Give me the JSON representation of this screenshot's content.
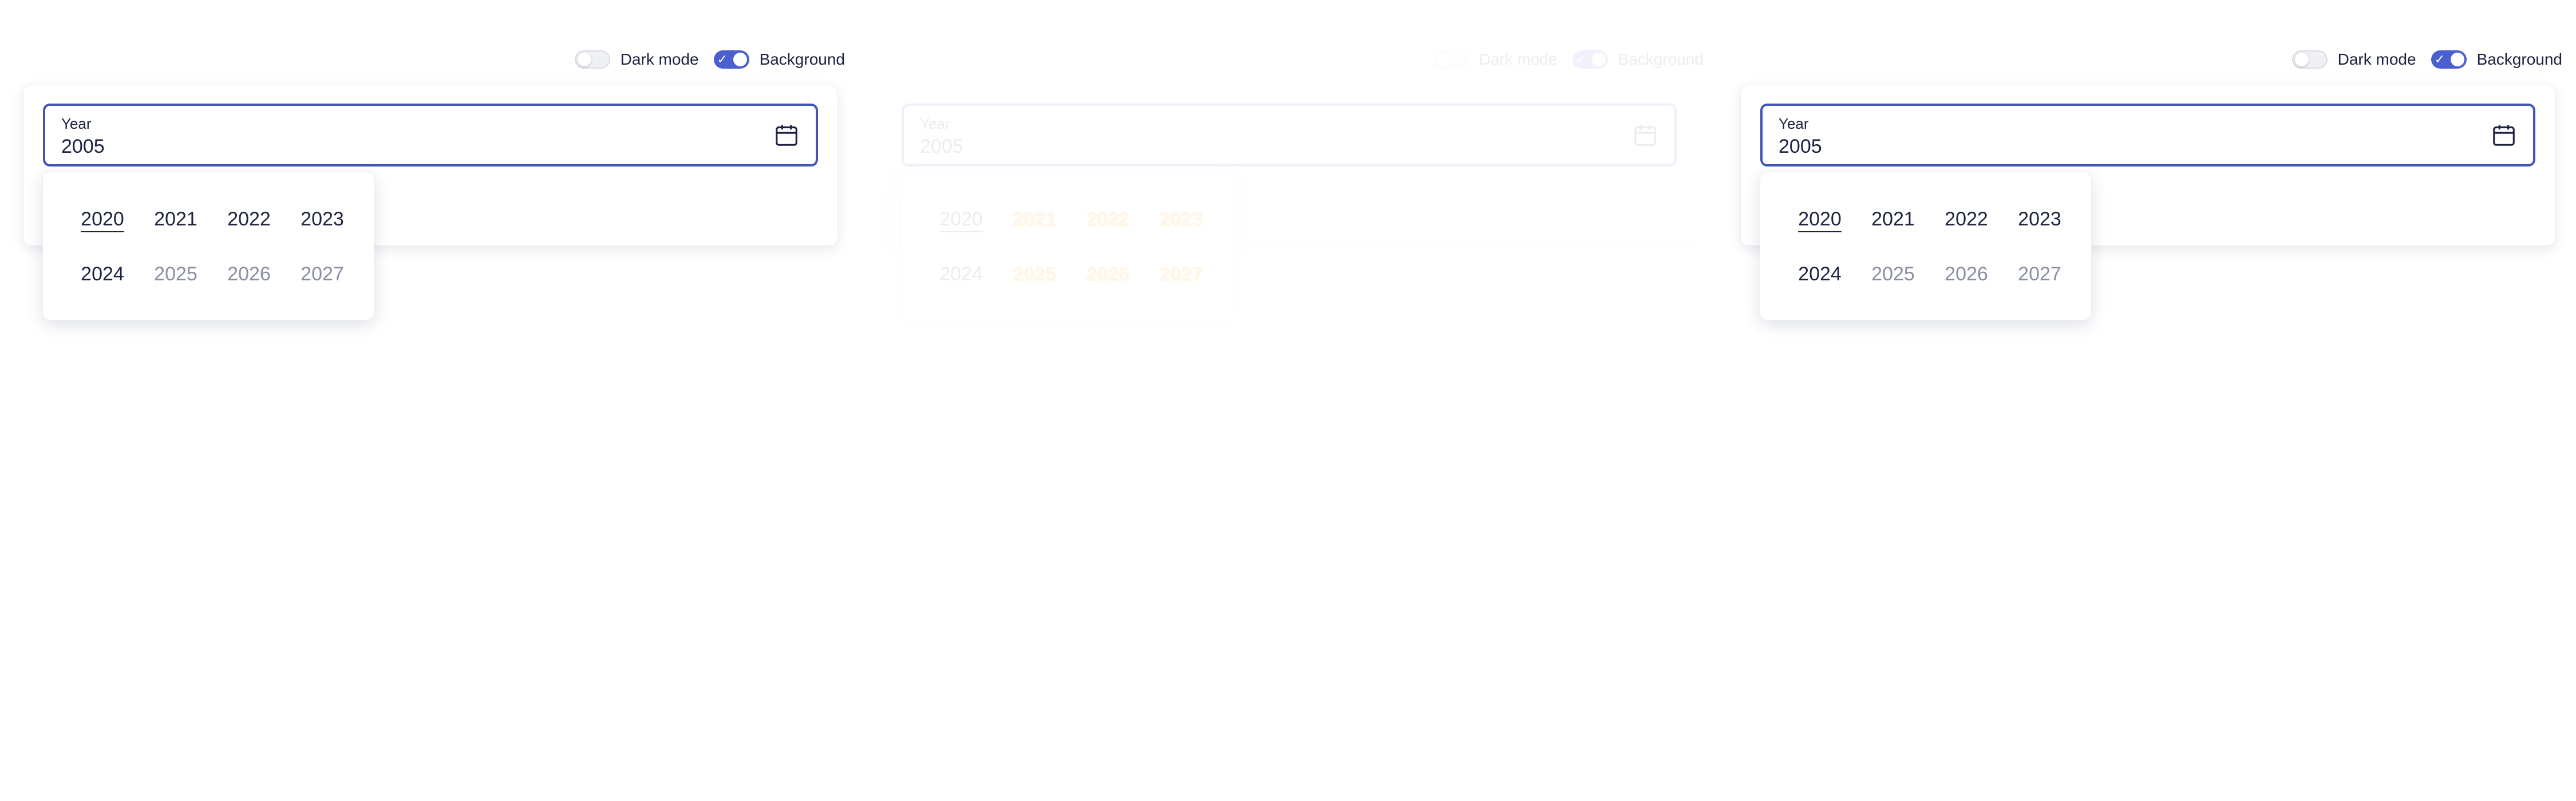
{
  "toggles": {
    "dark_mode_label": "Dark mode",
    "background_label": "Background"
  },
  "field": {
    "label": "Year",
    "value": "2005",
    "icon": "calendar-icon"
  },
  "years": [
    "2020",
    "2021",
    "2022",
    "2023",
    "2024",
    "2025",
    "2026",
    "2027"
  ],
  "colors": {
    "accent": "#4356b8",
    "switch_on": "#4a5fd0",
    "text": "#1d2240",
    "muted": "#8a8ea0"
  }
}
